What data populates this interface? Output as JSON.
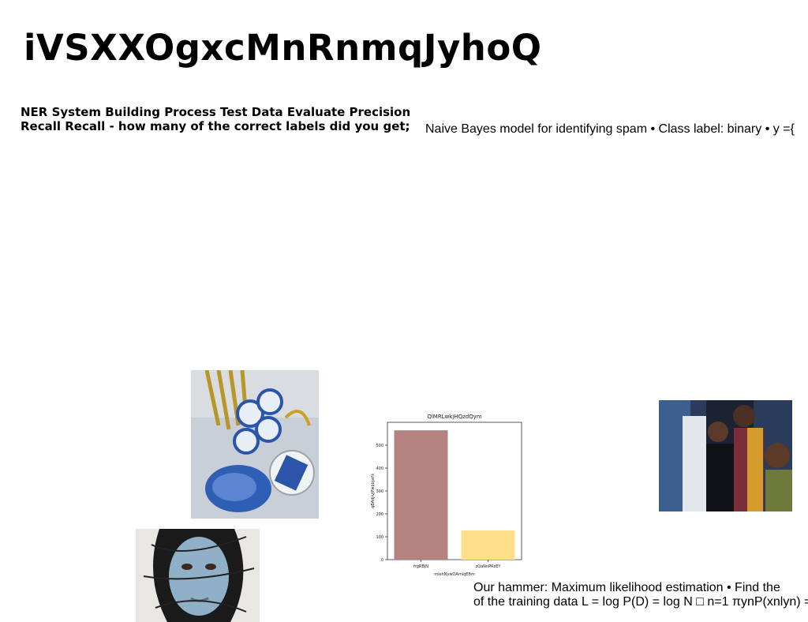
{
  "slide": {
    "title": "iVSXXOgxcMnRnmqJyhoQ",
    "bold_paragraph": "NER System Building Process Test Data Evaluate Precision Recall Recall - how many of the correct labels did you get;",
    "right_text": "Naive Bayes model for identifying spam • Class label: binary • y ={",
    "bottom_text_line1": "Our hammer: Maximum likelihood estimation • Find the",
    "bottom_text_line2": "of the training data L = log P(D) = log N □ n=1 πynP(xnlyn) ="
  },
  "images": {
    "dessert": "dessert-photo",
    "people": "people-photo",
    "face": "painted-face-photo"
  },
  "chart_data": {
    "type": "bar",
    "title": "QlMRLwkjHQzdQym",
    "xlabel": "miehNywOAmlqEBm",
    "ylabel": "qBAdjlvJPwbbjaYs",
    "categories": [
      "frgRBJN",
      "zQaNnPRzEY"
    ],
    "values": [
      565,
      128
    ],
    "colors": [
      "#b5837f",
      "#ffe08a"
    ],
    "ylim": [
      0,
      600
    ],
    "yticks": [
      0,
      100,
      200,
      300,
      400,
      500
    ],
    "grid": false
  }
}
